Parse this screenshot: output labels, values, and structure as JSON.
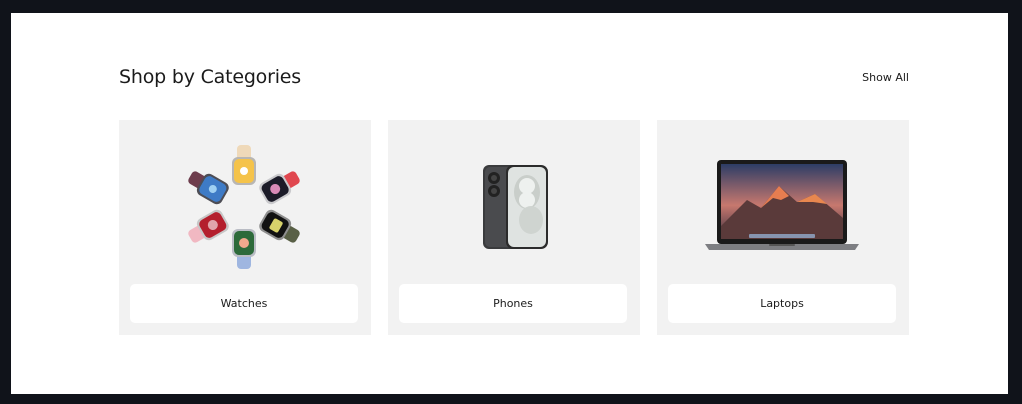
{
  "section": {
    "title": "Shop by Categories",
    "show_all_label": "Show All"
  },
  "categories": [
    {
      "label": "Watches",
      "icon": "watches-image"
    },
    {
      "label": "Phones",
      "icon": "phones-image"
    },
    {
      "label": "Laptops",
      "icon": "laptops-image"
    }
  ],
  "colors": {
    "page_background": "#10131a",
    "panel_background": "#ffffff",
    "card_background": "#f2f2f2",
    "text": "#1b1b1b"
  }
}
